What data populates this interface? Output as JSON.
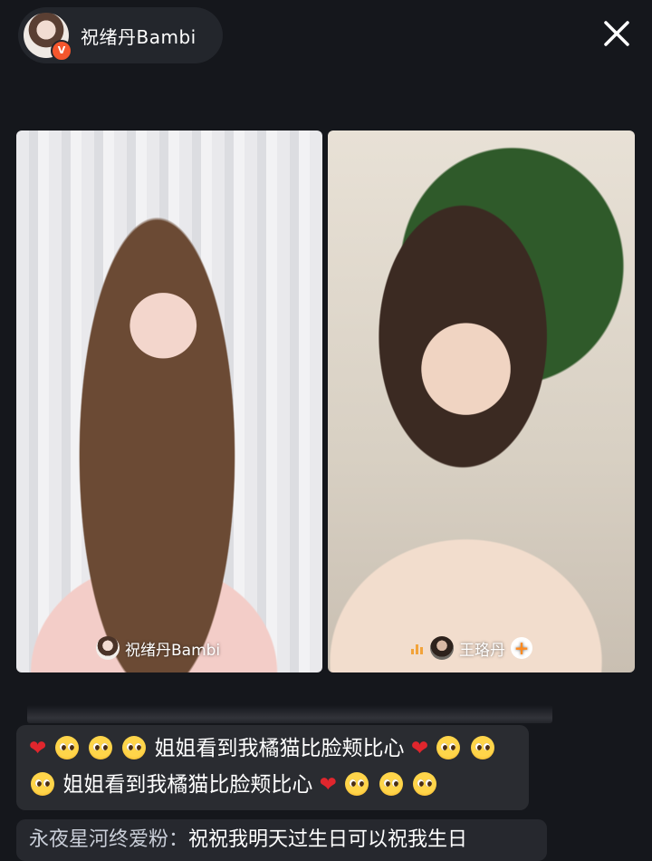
{
  "host": {
    "name": "祝绪丹Bambi",
    "verified_badge": "V"
  },
  "icons": {
    "close": "close-icon",
    "signal": "signal-bars-icon",
    "follow": "plus-icon"
  },
  "streams": {
    "left": {
      "name": "祝绪丹Bambi"
    },
    "right": {
      "name": "王珞丹",
      "follow_label": "+"
    }
  },
  "comments": {
    "highlight_text": "姐姐看到我橘猫比脸颊比心",
    "c3_user": "永夜星河终爱粉：",
    "c3_text": "祝祝我明天过生日可以祝我生日"
  },
  "colors": {
    "background": "#15171c",
    "badge": "#f4562d",
    "heart": "#e0262d",
    "follow_accent": "#ff8a1f"
  }
}
